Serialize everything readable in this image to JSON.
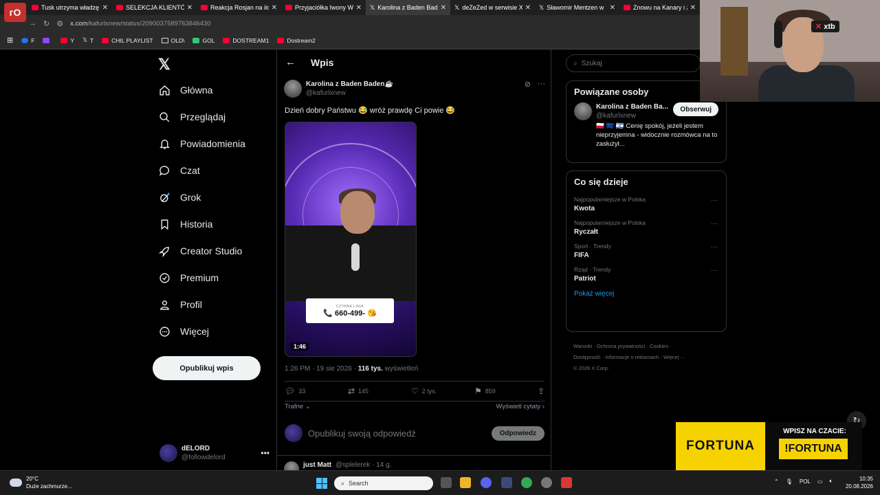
{
  "browser": {
    "logo_text": "ᴦO",
    "tabs": [
      {
        "title": "Tusk utrzyma władzę",
        "icon": "youtube"
      },
      {
        "title": "SELEKCJA KLIENTÓW",
        "icon": "youtube"
      },
      {
        "title": "Reakcja Rosjan na ilości",
        "icon": "youtube"
      },
      {
        "title": "Przyjaciółka Iwony W",
        "icon": "youtube"
      },
      {
        "title": "Karolina z Baden Bad",
        "icon": "x"
      },
      {
        "title": "deZeZed w serwisie X",
        "icon": "x"
      },
      {
        "title": "Sławomir Mentzen w",
        "icon": "x"
      },
      {
        "title": "Znowu na Kanary i z",
        "icon": "youtube"
      }
    ],
    "url_host": "x.com",
    "url_path": "/kafurlxnew/status/2090037589763846430",
    "bookmarks": [
      {
        "label": "F",
        "icon": "facebook"
      },
      {
        "label": "",
        "icon": "twitch"
      },
      {
        "label": "Y",
        "icon": "youtube"
      },
      {
        "label": "T",
        "icon": "x"
      },
      {
        "label": "CHIL PLAYLIST",
        "icon": "youtube"
      },
      {
        "label": "OLD\\",
        "icon": "folder"
      },
      {
        "label": "GOL",
        "icon": "green"
      },
      {
        "label": "DOSTREAM1",
        "icon": "youtube"
      },
      {
        "label": "Dostream2",
        "icon": "youtube"
      }
    ]
  },
  "sidebar": {
    "logo": "𝕏",
    "items": [
      {
        "label": "Główna",
        "icon": "home-icon"
      },
      {
        "label": "Przeglądaj",
        "icon": "search-icon"
      },
      {
        "label": "Powiadomienia",
        "icon": "bell-icon"
      },
      {
        "label": "Czat",
        "icon": "chat-icon"
      },
      {
        "label": "Grok",
        "icon": "grok-icon"
      },
      {
        "label": "Historia",
        "icon": "bookmark-icon"
      },
      {
        "label": "Creator Studio",
        "icon": "rocket-icon"
      },
      {
        "label": "Premium",
        "icon": "verified-icon"
      },
      {
        "label": "Profil",
        "icon": "person-icon"
      },
      {
        "label": "Więcej",
        "icon": "more-circle-icon"
      }
    ],
    "publish_label": "Opublikuj wpis",
    "account": {
      "name": "dELORD",
      "handle": "@followdelord"
    }
  },
  "main": {
    "title": "Wpis",
    "post": {
      "author_name": "Karolina z Baden Baden☕",
      "author_handle": "@kafurlxnew",
      "text": "Dzień dobry Państwu 😂 wróż prawdę Ci powie 😂",
      "video_phone_label": "CZYNNA LINIA",
      "video_phone_number": "660-499-",
      "duration": "1:46",
      "time": "1:26 PM · 19 sie 2026 · ",
      "views_count": "116 tys.",
      "views_label": " wyświetleń",
      "replies": "33",
      "reposts": "145",
      "likes": "2 tys.",
      "bookmarks": "859"
    },
    "sort_label": "Trafne",
    "quotes_label": "Wyświetl cytaty",
    "reply_placeholder": "Opublikuj swoją odpowiedź",
    "reply_button": "Odpowiedz",
    "next_post": {
      "name": "just Matt",
      "handle": "@splelerek · 14 g."
    }
  },
  "right": {
    "search_placeholder": "Szukaj",
    "related_title": "Powiązane osoby",
    "related_person": {
      "name": "Karolina z Baden Ba...",
      "handle": "@kafurlxnew",
      "follow": "Obserwuj",
      "bio": "🇵🇱 🇪🇺 🇮🇱 Cenię spokój, jeżeli jestem nieprzyjemna - widocznie rozmówca na to zasłużył..."
    },
    "trends_title": "Co się dzieje",
    "trends": [
      {
        "category": "Najpopularniejsze w Polska",
        "title": "Kwota"
      },
      {
        "category": "Najpopularniejsze w Polska",
        "title": "Ryczałt"
      },
      {
        "category": "Sport · Trendy",
        "title": "FIFA"
      },
      {
        "category": "Rząd · Trendy",
        "title": "Patriot"
      }
    ],
    "show_more": "Pokaż więcej",
    "footer_line1": "Warunki · Ochrona prywatności · Cookies ·",
    "footer_line2": "Dostępność · Informacje o reklamach · Więcej ···",
    "footer_line3": "© 2026 X Corp."
  },
  "overlay": {
    "xtb_label": "xtb",
    "ad_brand": "FORTUNA",
    "ad_call": "WPISZ NA CZACIE:",
    "ad_command": "!FORTUNA"
  },
  "taskbar": {
    "temp": "20°C",
    "weather": "Duże zachmurze...",
    "search": "Search",
    "lang": "POL",
    "time": "10:35",
    "date": "20.08.2026"
  },
  "colors": {
    "accent": "#1d9bf0",
    "fortuna_yellow": "#f6d300"
  }
}
